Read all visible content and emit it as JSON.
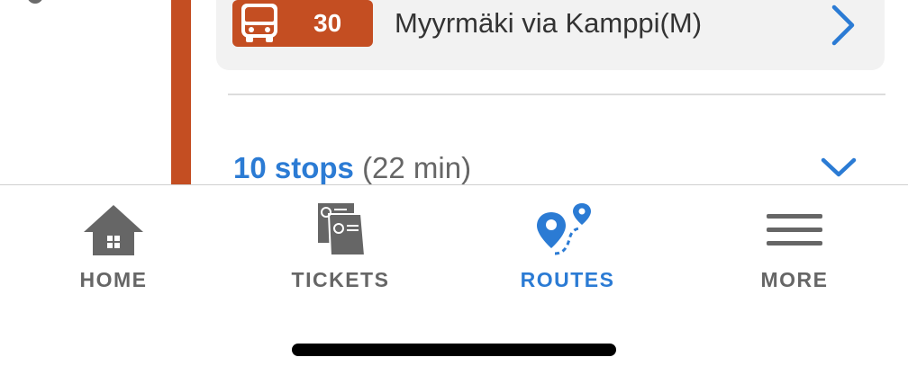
{
  "leg": {
    "bus_number": "30",
    "destination": "Myyrmäki via Kamppi(M)",
    "stops_count": "10 stops",
    "stops_duration": "(22 min)",
    "route_color": "#c44e22"
  },
  "tabs": [
    {
      "label": "HOME",
      "icon": "home-icon",
      "active": false
    },
    {
      "label": "TICKETS",
      "icon": "tickets-icon",
      "active": false
    },
    {
      "label": "ROUTES",
      "icon": "routes-icon",
      "active": true
    },
    {
      "label": "MORE",
      "icon": "menu-icon",
      "active": false
    }
  ],
  "colors": {
    "accent": "#2b7bd4",
    "inactive": "#666666",
    "bus": "#c44e22"
  }
}
